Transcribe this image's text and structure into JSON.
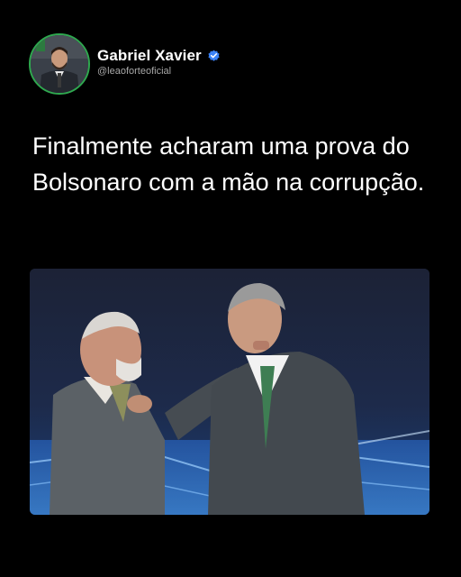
{
  "author": {
    "name": "Gabriel Xavier",
    "handle": "@leaoforteoficial",
    "verified": true,
    "avatar_icon": "avatar-photo",
    "verified_icon": "verified-badge-icon",
    "verified_color": "#3b82f6"
  },
  "post": {
    "text": "Finalmente acharam uma prova do Bolsonaro com a mão na corrupção."
  },
  "media": {
    "type": "photo"
  },
  "colors": {
    "background": "#000000",
    "text": "#ffffff",
    "handle": "#a8a8a8",
    "avatar_ring": "#2fa84f"
  }
}
